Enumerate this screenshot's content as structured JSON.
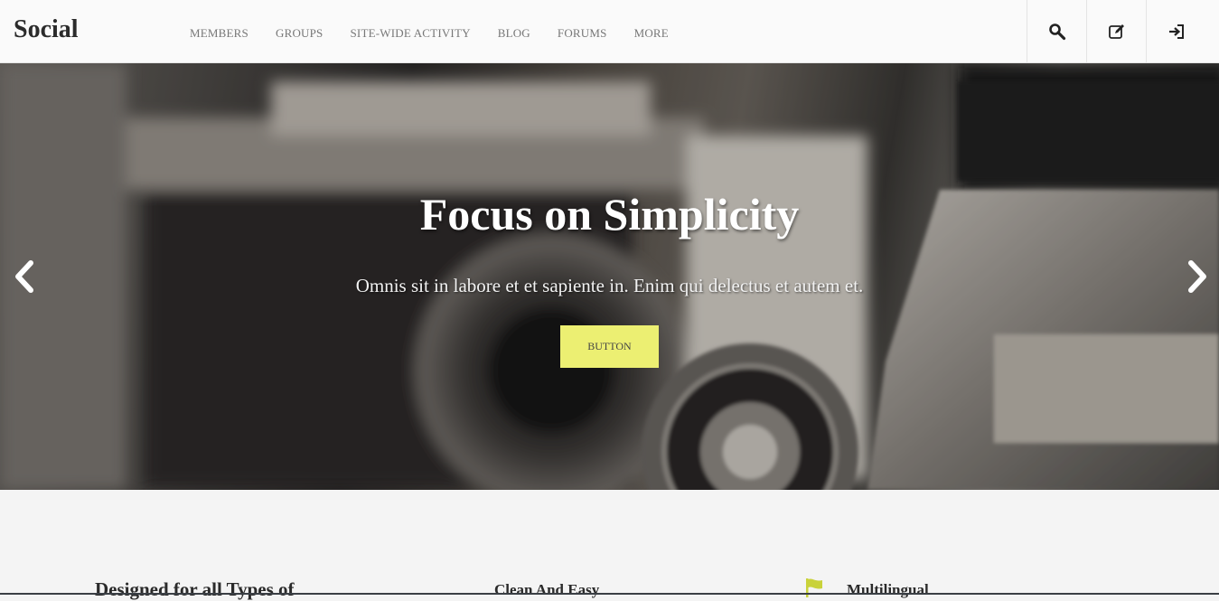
{
  "header": {
    "logo": "Social",
    "nav": [
      {
        "label": "MEMBERS"
      },
      {
        "label": "GROUPS"
      },
      {
        "label": "SITE-WIDE ACTIVITY"
      },
      {
        "label": "BLOG"
      },
      {
        "label": "FORUMS"
      },
      {
        "label": "MORE"
      }
    ],
    "tools": [
      {
        "icon": "search-icon"
      },
      {
        "icon": "edit-icon"
      },
      {
        "icon": "login-icon"
      }
    ]
  },
  "hero": {
    "title": "Focus on Simplicity",
    "subtitle": "Omnis sit in labore et et sapiente in. Enim qui delectus et autem et.",
    "button_label": "BUTTON",
    "prev_icon": "chevron-left-icon",
    "next_icon": "chevron-right-icon"
  },
  "features": {
    "heading": "Designed for all Types of",
    "items": [
      {
        "label": "Clean And Easy"
      },
      {
        "label": "Multilingual",
        "icon": "flag-icon"
      }
    ]
  },
  "colors": {
    "accent": "#ecef72",
    "flag": "#c9d23a",
    "header_bg": "#fafafa",
    "body_bg": "#f4f4f4"
  }
}
